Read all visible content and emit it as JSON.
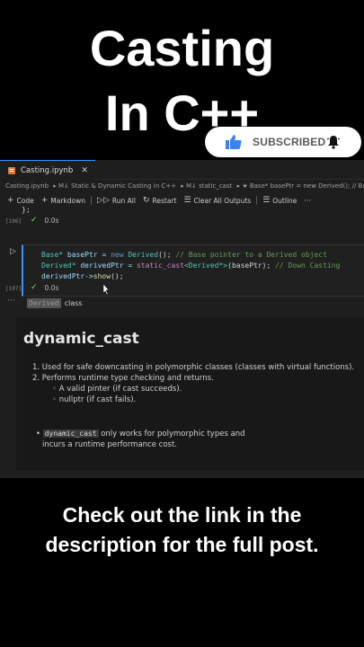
{
  "overlay": {
    "title_line1": "Casting",
    "title_line2": "In C++",
    "subscribe_label": "SUBSCRIBED",
    "subscribe_icon": "thumbs-up-icon",
    "bell_icon": "bell-icon",
    "caption_line1": "Check out the link in the",
    "caption_line2": "description for the full post."
  },
  "editor": {
    "tab_label": "Casting.ipynb",
    "breadcrumb": [
      "Casting.ipynb",
      "▸ M↓ Static & Dynamic Casting in C++",
      "▸ M↓ static_cast",
      "▸ ★ Base* basePtr = new Derived(); // Ba"
    ],
    "toolbar": {
      "code": "Code",
      "markdown": "Markdown",
      "run_all": "Run All",
      "restart": "Restart",
      "clear_outputs": "Clear All Outputs",
      "outline": "Outline",
      "more": "···"
    },
    "prev_cell_tail": "};",
    "prev_exec_count": "[106]",
    "prev_exec_time": "0.0s",
    "cell": {
      "line1_type": "Base*",
      "line1_var": " basePtr = ",
      "line1_new": "new",
      "line1_ctor": " Derived",
      "line1_end": "(); ",
      "line1_comment": "// Base pointer to a Derived object",
      "line2_type": "Derived*",
      "line2_var": " derivedPtr = ",
      "line2_cast": "static_cast",
      "line2_tmpl": "<Derived*>",
      "line2_end": "(basePtr); ",
      "line2_comment": "// Down Casting",
      "line3_var": "derivedPtr->",
      "line3_fn": "show",
      "line3_end": "();",
      "exec_count": "[107]",
      "exec_time": "0.0s"
    },
    "output_highlight": "Derived",
    "output_text": "class",
    "markdown": {
      "heading": "dynamic_cast",
      "item1": "1. Used for safe downcasting in polymorphic classes (classes with virtual functions).",
      "item2": "2. Performs runtime type checking and returns.",
      "sub1": "◦ A valid pinter (if cast succeeds).",
      "sub2": "◦ nullptr (if cast fails).",
      "bullet_code": "dynamic_cast",
      "bullet_text1": " only works for polymorphic types and",
      "bullet_text2": "incurs a runtime performance cost."
    }
  }
}
